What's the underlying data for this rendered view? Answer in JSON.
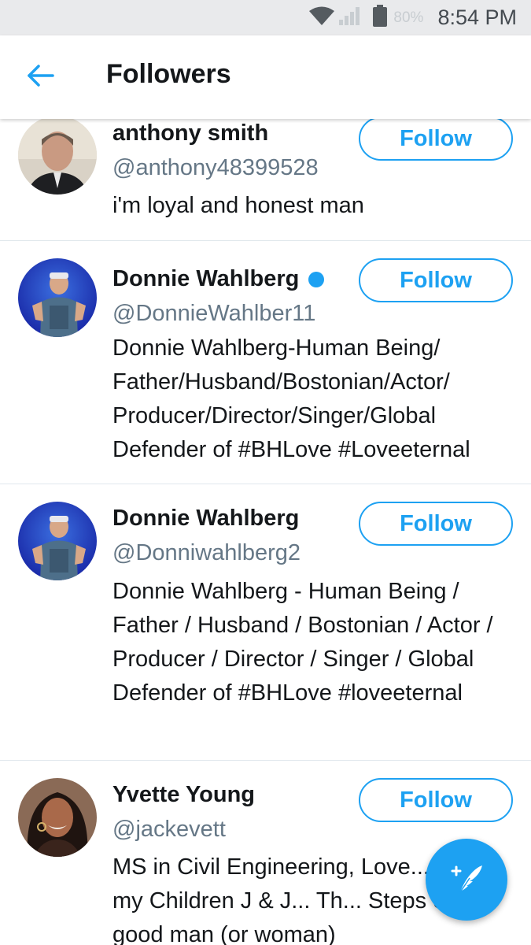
{
  "status_bar": {
    "battery_percent": "80%",
    "time": "8:54 PM"
  },
  "header": {
    "title": "Followers",
    "back_icon": "arrow-left-icon"
  },
  "followers": [
    {
      "name": "anthony smith",
      "handle": "@anthony48399528",
      "bio": "i'm loyal and honest man",
      "verified": false,
      "follow_label": "Follow"
    },
    {
      "name": "Donnie Wahlberg",
      "handle": "@DonnieWahlber11",
      "bio": "Donnie Wahlberg-Human Being/ Father/Husband/Bostonian/Actor/ Producer/Director/Singer/Global Defender of #BHLove #Loveeternal",
      "verified": true,
      "follow_label": "Follow"
    },
    {
      "name": "Donnie Wahlberg",
      "handle": "@Donniwahlberg2",
      "bio": "Donnie Wahlberg - Human Being / Father / Husband / Bostonian / Actor / Producer / Director / Singer / Global Defender of #BHLove #loveeternal",
      "verified": false,
      "follow_label": "Follow"
    },
    {
      "name": "Yvette Young",
      "handle": "@jackevett",
      "bio": "MS in Civil Engineering, Love... Love my Children J & J... Th... Steps of a good man (or woman)",
      "verified": false,
      "follow_label": "Follow"
    }
  ],
  "fab": {
    "icon": "compose-tweet-icon"
  },
  "colors": {
    "accent": "#1da1f2",
    "text_primary": "#14171a",
    "text_secondary": "#657786",
    "divider": "#e1e8ed"
  }
}
